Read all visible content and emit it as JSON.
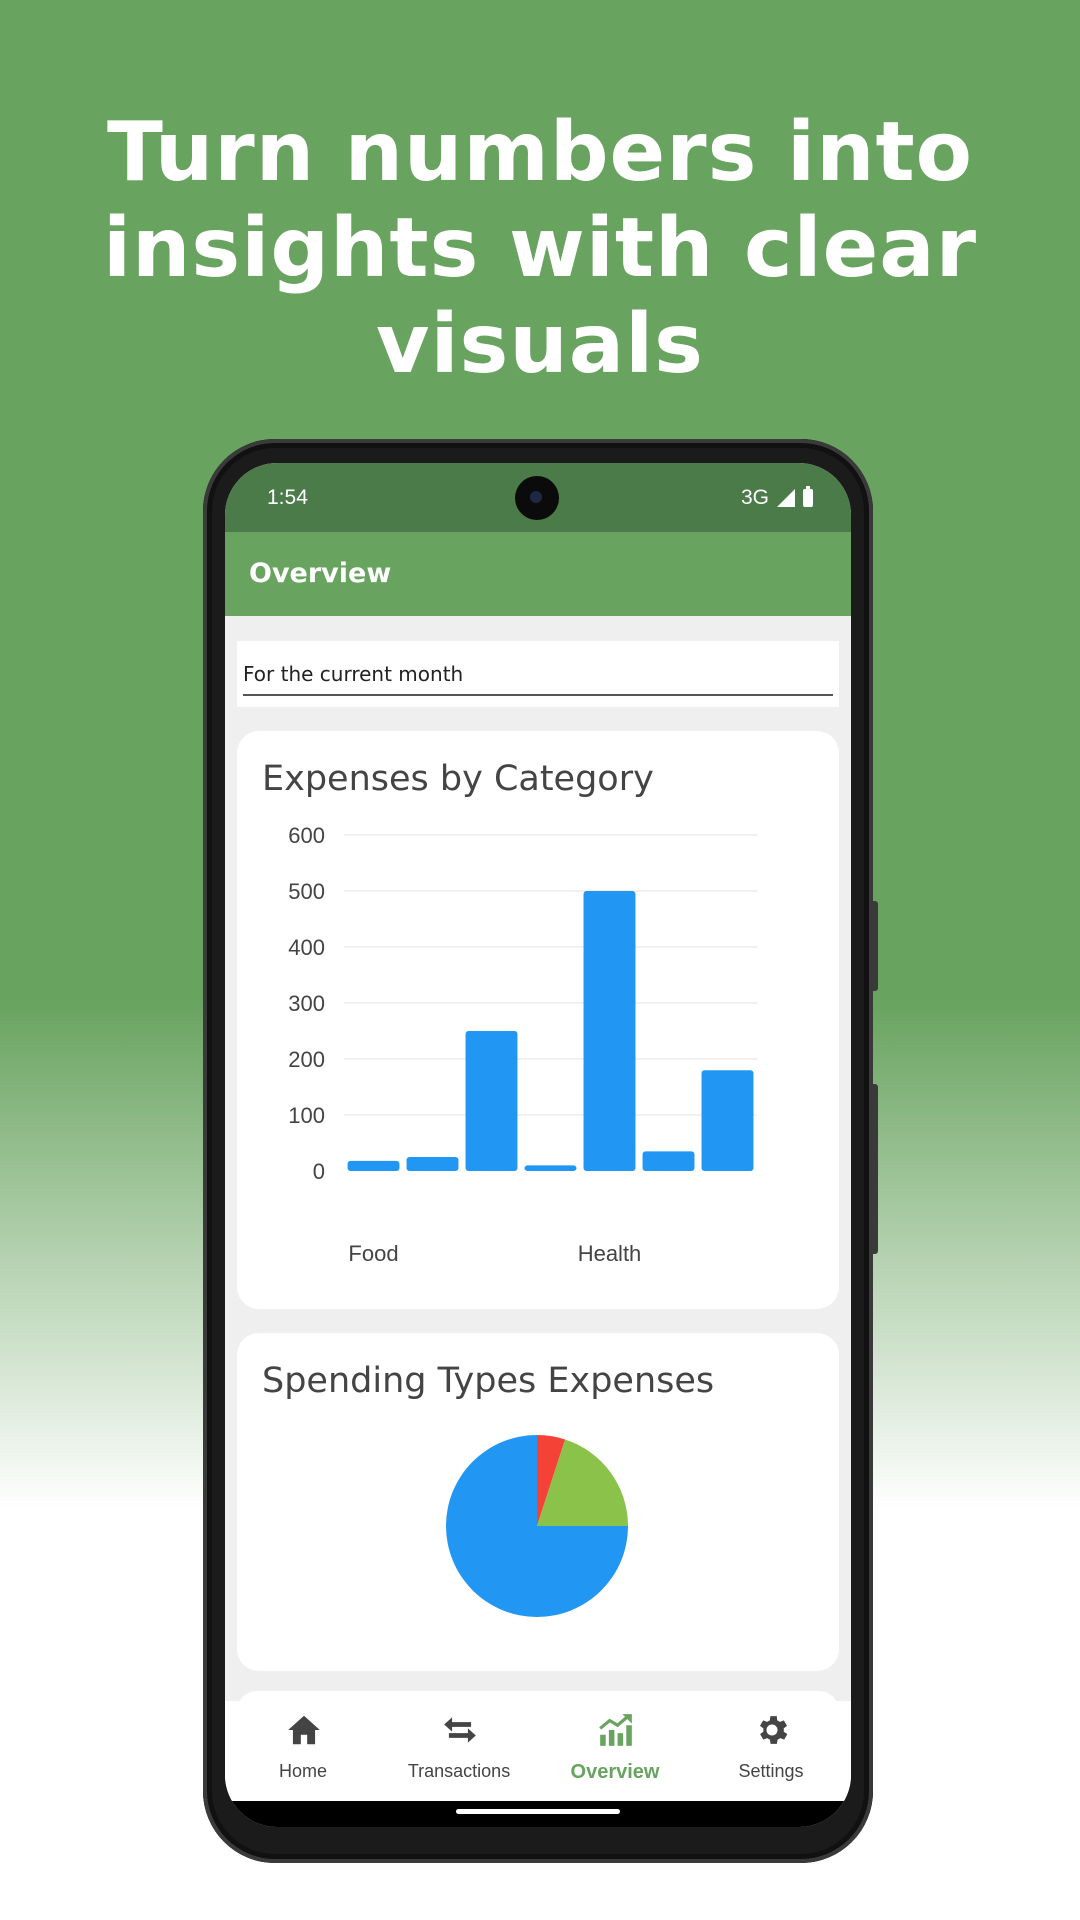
{
  "headline": {
    "line1": "Turn numbers into",
    "line2": "insights with clear",
    "line3": "visuals"
  },
  "status_bar": {
    "time": "1:54",
    "network": "3G"
  },
  "app_bar": {
    "title": "Overview"
  },
  "period": {
    "value": "For the current month"
  },
  "colors": {
    "primary": "#68a35f",
    "status_bar": "#4b7b48",
    "bar": "#2196f3",
    "pie_blue": "#2196f3",
    "pie_red": "#f44336",
    "pie_green": "#8bc34a"
  },
  "expenses_card": {
    "title": "Expenses by Category"
  },
  "spending_card": {
    "title": "Spending Types Expenses"
  },
  "chart_data": [
    {
      "type": "bar",
      "title": "Expenses by Category",
      "categories": [
        "Food",
        "",
        "",
        "",
        "Health",
        "",
        ""
      ],
      "visible_x_labels": [
        "Food",
        "Health"
      ],
      "values": [
        18,
        25,
        250,
        10,
        500,
        35,
        180
      ],
      "ylim": [
        0,
        600
      ],
      "y_ticks": [
        0,
        100,
        200,
        300,
        400,
        500,
        600
      ],
      "grid": true,
      "legend": "none"
    },
    {
      "type": "pie",
      "title": "Spending Types Expenses",
      "values": [
        75,
        5,
        20
      ],
      "colors": [
        "#2196f3",
        "#f44336",
        "#8bc34a"
      ],
      "legend": "none"
    }
  ],
  "bottom_nav": {
    "items": [
      {
        "label": "Home",
        "icon": "home-icon"
      },
      {
        "label": "Transactions",
        "icon": "swap-arrows-icon"
      },
      {
        "label": "Overview",
        "icon": "chart-trend-icon"
      },
      {
        "label": "Settings",
        "icon": "gear-icon"
      }
    ],
    "active": "Overview"
  }
}
